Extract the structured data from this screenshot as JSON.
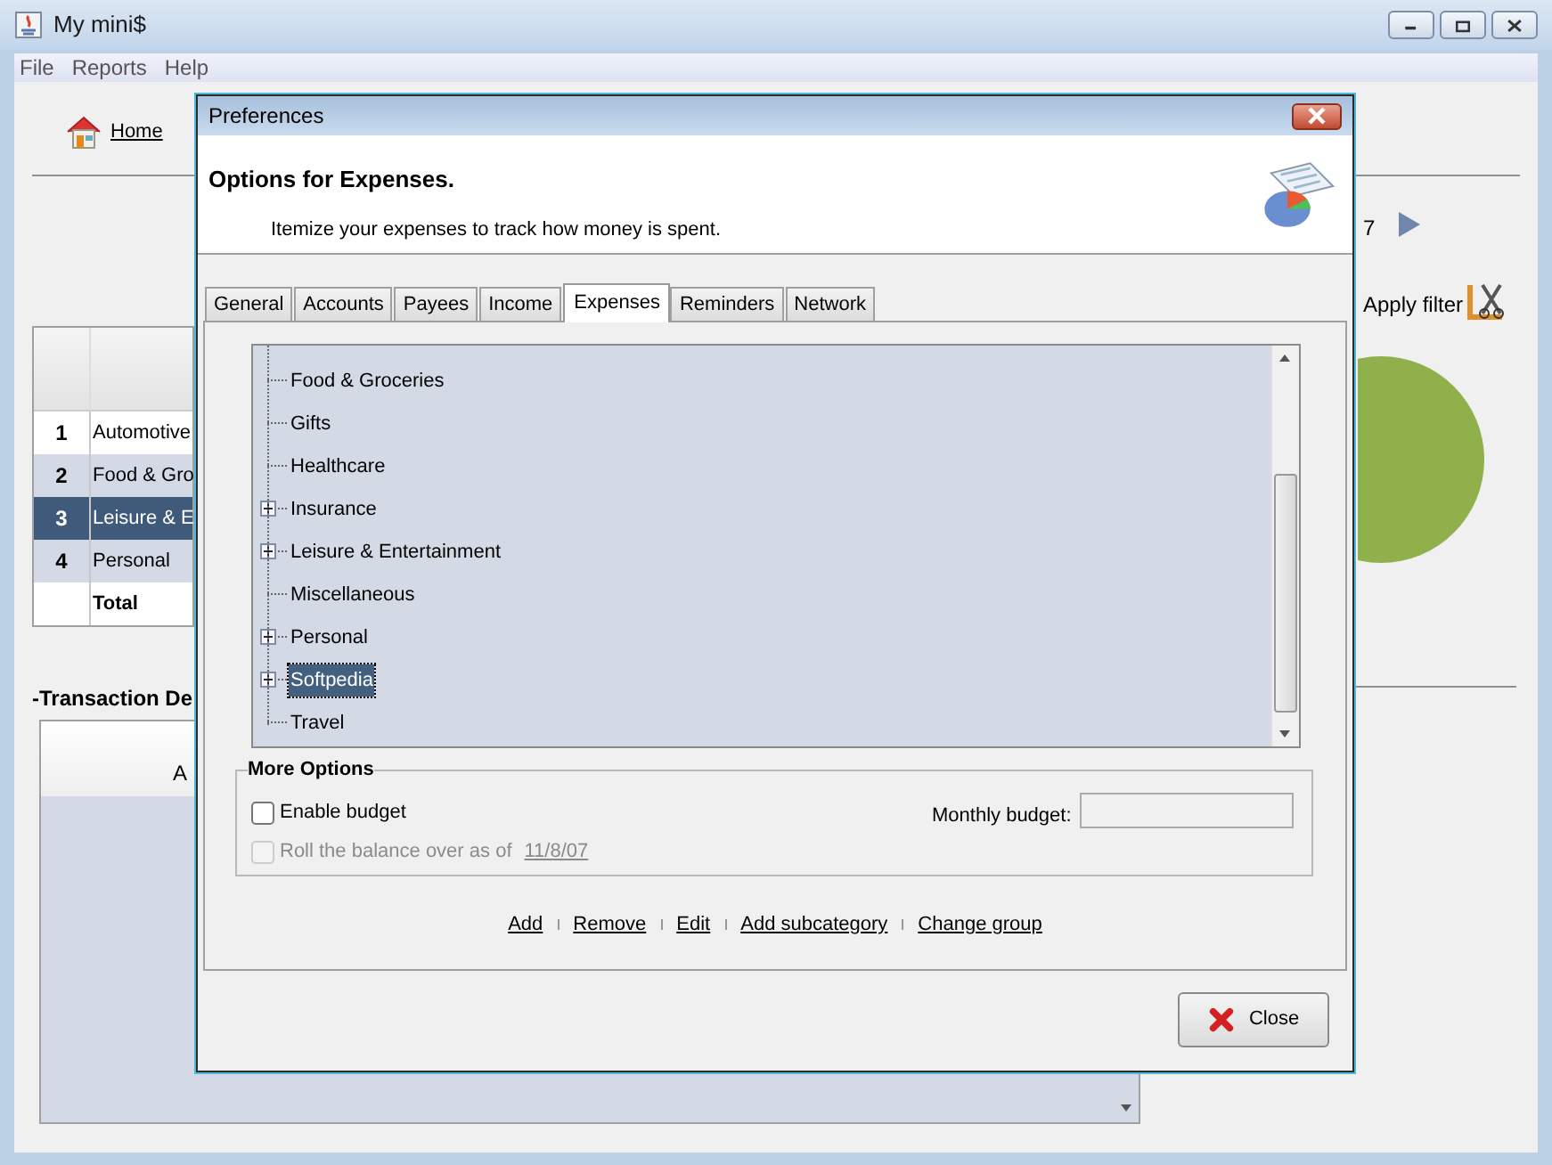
{
  "window": {
    "title": "My mini$"
  },
  "menu": [
    "File",
    "Reports",
    "Help"
  ],
  "home_link": "Home",
  "summary_table": {
    "rows": [
      {
        "number": "1",
        "category": "Automotive",
        "selected": false
      },
      {
        "number": "2",
        "category": "Food & Gro",
        "selected": false
      },
      {
        "number": "3",
        "category": "Leisure & E",
        "selected": true
      },
      {
        "number": "4",
        "category": "Personal",
        "selected": false
      },
      {
        "number": "",
        "category": "Total",
        "selected": false
      }
    ]
  },
  "transaction_section": {
    "title": "-Transaction De",
    "column_1": "A"
  },
  "date_fragment": "7",
  "apply_filter": "Apply filter",
  "dialog": {
    "title": "Preferences",
    "heading": "Options for Expenses.",
    "subtitle": "Itemize your expenses to track how money is spent.",
    "tabs": [
      {
        "label": "General",
        "selected": false
      },
      {
        "label": "Accounts",
        "selected": false
      },
      {
        "label": "Payees",
        "selected": false
      },
      {
        "label": "Income",
        "selected": false
      },
      {
        "label": "Expenses",
        "selected": true
      },
      {
        "label": "Reminders",
        "selected": false
      },
      {
        "label": "Network",
        "selected": false
      }
    ],
    "categories": [
      {
        "label": "Food & Groceries",
        "expandable": false,
        "selected": false
      },
      {
        "label": "Gifts",
        "expandable": false,
        "selected": false
      },
      {
        "label": "Healthcare",
        "expandable": false,
        "selected": false
      },
      {
        "label": "Insurance",
        "expandable": true,
        "selected": false
      },
      {
        "label": "Leisure & Entertainment",
        "expandable": true,
        "selected": false
      },
      {
        "label": "Miscellaneous",
        "expandable": false,
        "selected": false
      },
      {
        "label": "Personal",
        "expandable": true,
        "selected": false
      },
      {
        "label": "Softpedia",
        "expandable": true,
        "selected": true
      },
      {
        "label": "Travel",
        "expandable": false,
        "selected": false
      }
    ],
    "more_options": {
      "title": "More Options",
      "enable_budget": {
        "label": "Enable budget",
        "checked": false,
        "disabled": false
      },
      "monthly_budget": {
        "label": "Monthly budget:"
      },
      "roll_balance": {
        "label": "Roll the balance over as of",
        "date": "11/8/07",
        "checked": false,
        "disabled": true
      }
    },
    "actions": [
      "Add",
      "Remove",
      "Edit",
      "Add subcategory",
      "Change group"
    ],
    "close_button": "Close"
  }
}
